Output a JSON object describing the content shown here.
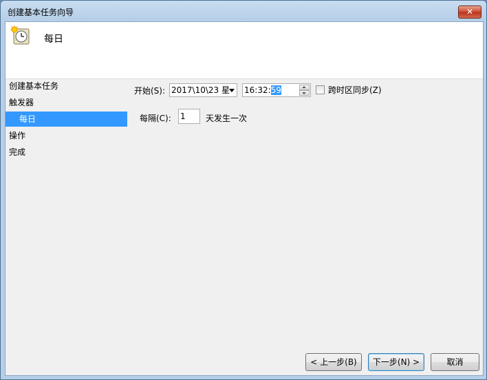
{
  "window": {
    "title": "创建基本任务向导",
    "close_label": "✕"
  },
  "header": {
    "icon": "clock-icon",
    "title": "每日"
  },
  "sidebar": {
    "items": [
      {
        "label": "创建基本任务"
      },
      {
        "label": "触发器"
      },
      {
        "label": "每日"
      },
      {
        "label": "操作"
      },
      {
        "label": "完成"
      }
    ]
  },
  "form": {
    "start_label": "开始(S):",
    "date_value": "2017\\10\\23 星",
    "time_prefix": "16:32:",
    "time_selected": "59",
    "sync_label": "跨时区同步(Z)",
    "recur_label": "每隔(C):",
    "recur_value": "1",
    "recur_suffix": "天发生一次"
  },
  "buttons": {
    "back": "< 上一步(B)",
    "next": "下一步(N) >",
    "cancel": "取消"
  }
}
